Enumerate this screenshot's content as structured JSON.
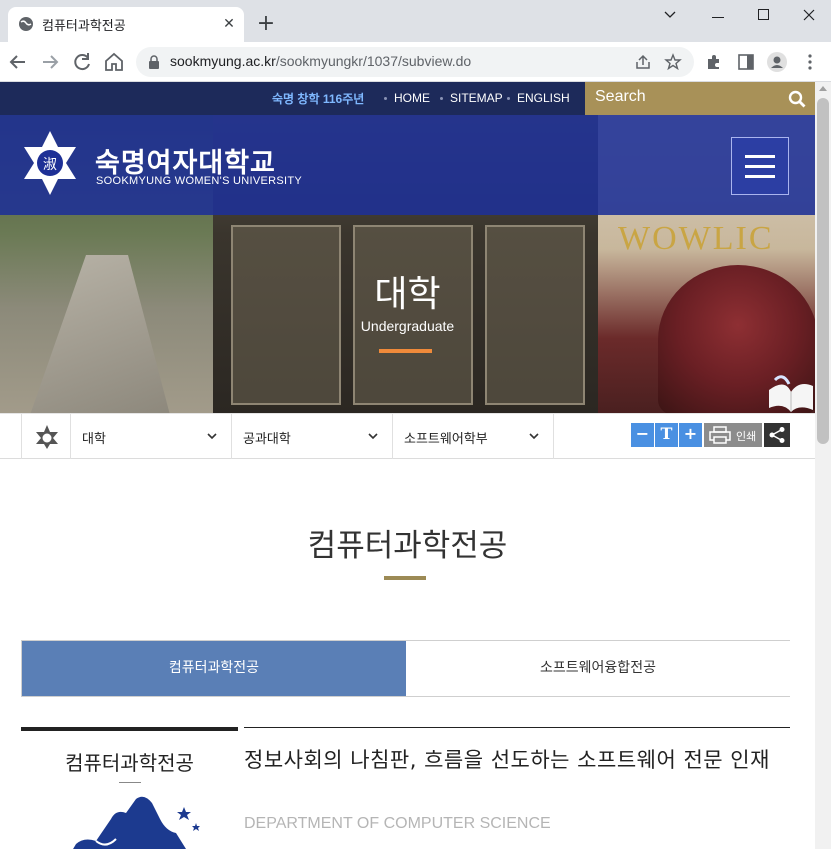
{
  "browser": {
    "tab_title": "컴퓨터과학전공",
    "url_host": "sookmyung.ac.kr",
    "url_path": "/sookmyungkr/1037/subview.do"
  },
  "util": {
    "anniversary": "숙명 창학 116주년",
    "links": [
      "HOME",
      "SITEMAP",
      "ENGLISH"
    ],
    "search_placeholder": "Search"
  },
  "header": {
    "logo_ko": "숙명여자대학교",
    "logo_en": "SOOKMYUNG WOMEN'S UNIVERSITY"
  },
  "hero": {
    "title": "대학",
    "subtitle": "Undergraduate",
    "sign_text": "WOWLIC"
  },
  "breadcrumb": {
    "items": [
      "대학",
      "공과대학",
      "소프트웨어학부"
    ]
  },
  "tools": {
    "font_minus": "−",
    "font_reset": "T",
    "font_plus": "+",
    "print_label": "인쇄"
  },
  "main": {
    "page_title": "컴퓨터과학전공",
    "tabs": [
      {
        "label": "컴퓨터과학전공",
        "active": true
      },
      {
        "label": "소프트웨어융합전공",
        "active": false
      }
    ],
    "card_title": "컴퓨터과학전공",
    "headline": "정보사회의 나침판, 흐름을 선도하는 소프트웨어 전문 인재",
    "department_en": "DEPARTMENT OF COMPUTER SCIENCE"
  },
  "colors": {
    "util_bg": "#1d2a5a",
    "search_bg": "#a89158",
    "header_overlay": "#1e3096",
    "tab_active": "#5a7fb6",
    "accent_orange": "#f08a3a",
    "title_bar": "#9c8a55"
  }
}
